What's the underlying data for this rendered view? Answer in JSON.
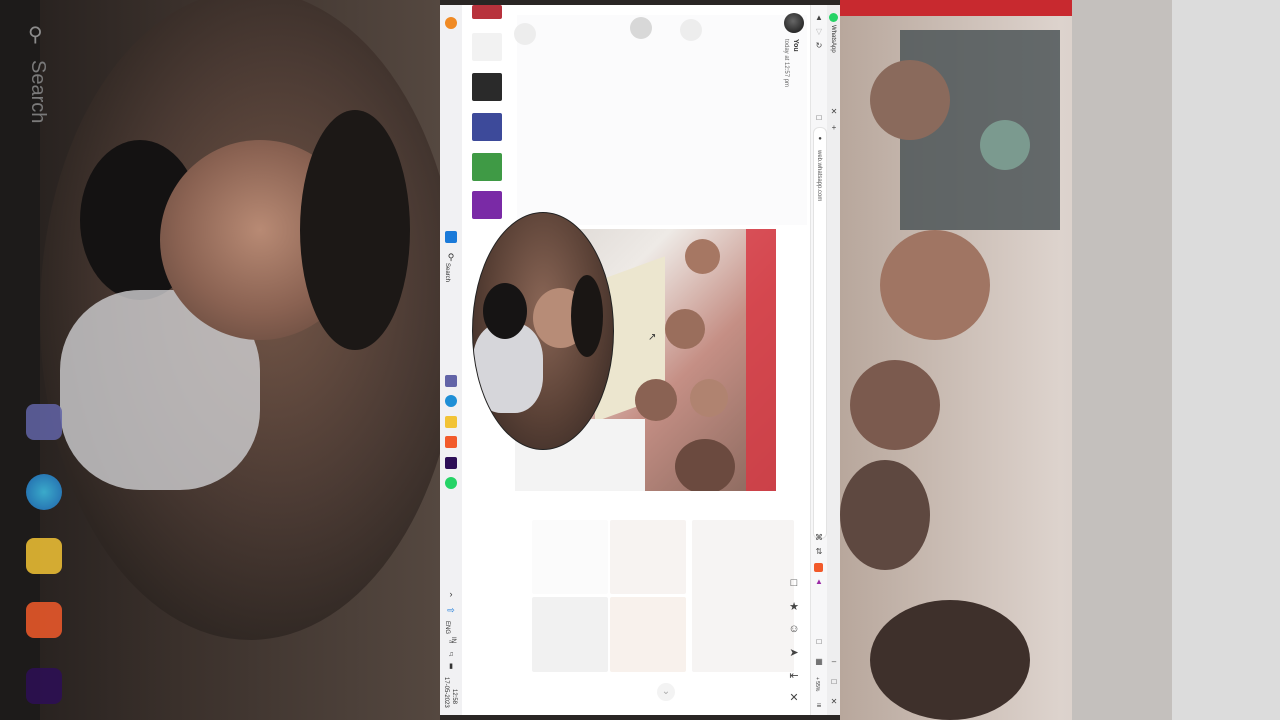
{
  "background": {
    "left_search_label": "Search"
  },
  "taskbar": {
    "search_label": "Search",
    "lang_label": "ENG",
    "lang_sub": "IN",
    "time": "12:58",
    "date": "17-05-2023",
    "icons": [
      "windows-icon",
      "search-icon",
      "teams-icon",
      "edge-icon",
      "files-icon",
      "brave-icon",
      "premiere-icon",
      "whatsapp-icon"
    ]
  },
  "chat": {
    "contact_name": "You",
    "timestamp": "today at 12:57 pm"
  },
  "browser": {
    "tab_title": "WhatsApp",
    "url": "web.whatsapp.com",
    "zoom": "+ 55%"
  },
  "colors": {
    "whatsapp_green": "#25d366",
    "accent_red": "#d73b45",
    "taskbar_bg": "#f1f1f3"
  }
}
